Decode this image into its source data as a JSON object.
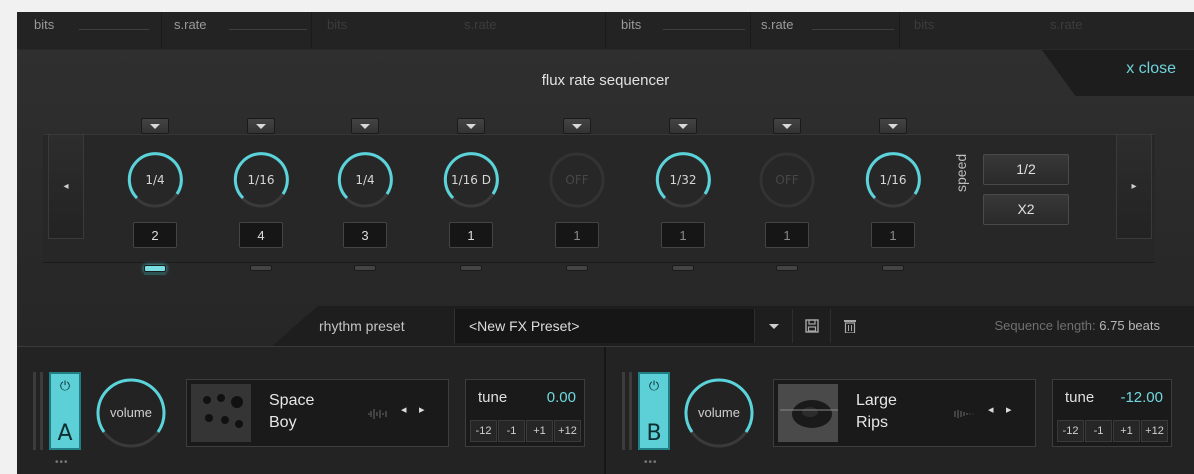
{
  "top_strip": {
    "labels": [
      "bits",
      "s.rate",
      "bits",
      "s.rate",
      "bits",
      "s.rate",
      "bits",
      "s.rate"
    ]
  },
  "sequencer": {
    "title": "flux rate sequencer",
    "close_label": "x close",
    "left_arrow": "◂",
    "right_arrow": "▸",
    "steps": [
      {
        "rate": "1/4",
        "count": "2",
        "enabled": true,
        "active": true
      },
      {
        "rate": "1/16",
        "count": "4",
        "enabled": true,
        "active": false
      },
      {
        "rate": "1/4",
        "count": "3",
        "enabled": true,
        "active": false
      },
      {
        "rate": "1/16 D",
        "count": "1",
        "enabled": true,
        "active": false
      },
      {
        "rate": "OFF",
        "count": "1",
        "enabled": false,
        "active": false
      },
      {
        "rate": "1/32",
        "count": "1",
        "enabled": true,
        "active": false
      },
      {
        "rate": "OFF",
        "count": "1",
        "enabled": false,
        "active": false
      },
      {
        "rate": "1/16",
        "count": "1",
        "enabled": true,
        "active": false
      }
    ],
    "speed": {
      "label": "speed",
      "buttons": [
        "1/2",
        "X2"
      ]
    }
  },
  "preset_bar": {
    "label": "rhythm preset",
    "value": "<New FX Preset>",
    "sequence_length_label": "Sequence length:",
    "sequence_length_value": "6.75 beats"
  },
  "instruments": [
    {
      "letter": "A",
      "power": "⏻",
      "volume_label": "volume",
      "name_line1": "Space",
      "name_line2": "Boy",
      "tune_label": "tune",
      "tune_value": "0.00",
      "tune_buttons": [
        "-12",
        "-1",
        "+1",
        "+12"
      ],
      "dots": "•••"
    },
    {
      "letter": "B",
      "power": "⏻",
      "volume_label": "volume",
      "name_line1": "Large",
      "name_line2": "Rips",
      "tune_label": "tune",
      "tune_value": "-12.00",
      "tune_buttons": [
        "-12",
        "-1",
        "+1",
        "+12"
      ],
      "dots": "•••"
    }
  ],
  "colors": {
    "accent": "#5dcfd6",
    "panel": "#2a2a2a",
    "background": "#f1f1f1"
  }
}
